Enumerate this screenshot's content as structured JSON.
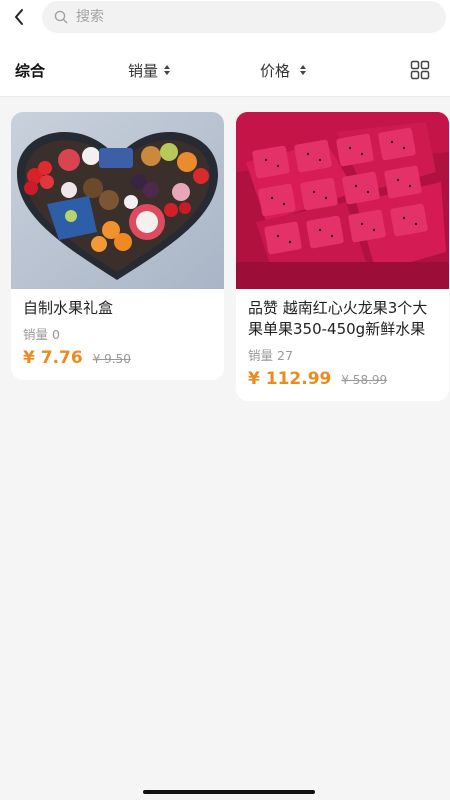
{
  "search": {
    "placeholder": "搜索"
  },
  "sort": {
    "items": [
      {
        "label": "综合"
      },
      {
        "label": "销量"
      },
      {
        "label": "价格"
      }
    ]
  },
  "icons": {
    "back": "chevron-left-icon",
    "search": "search-icon",
    "sort": "sort-arrows-icon",
    "grid": "grid-view-icon"
  },
  "colors": {
    "price": "#ee8a1c",
    "muted": "#9a9a9a",
    "background": "#f5f5f5"
  },
  "products": [
    {
      "title": "自制水果礼盒",
      "sales_label": "销量",
      "sales": "0",
      "price": "¥ 7.76",
      "original_price": "¥ 9.50"
    },
    {
      "title": "品赞 越南红心火龙果3个大果单果350-450g新鲜水果",
      "sales_label": "销量",
      "sales": "27",
      "price": "¥ 112.99",
      "original_price": "¥ 58.99"
    }
  ]
}
